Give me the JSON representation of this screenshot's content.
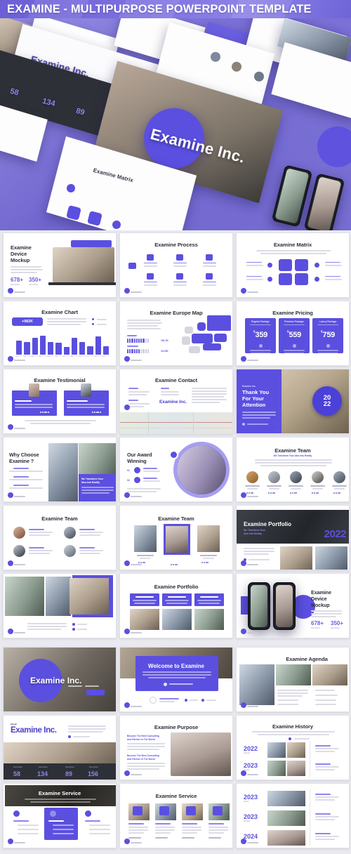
{
  "header": {
    "title": "EXAMINE - MULTIPURPOSE POWERPOINT TEMPLATE",
    "accent": "#5b4fe0",
    "gradient_from": "#6b5fd6",
    "gradient_to": "#8d83e8"
  },
  "hero": {
    "brand": "Examine Inc.",
    "circle_brand": "Examine Inc.",
    "stats": [
      {
        "value": "58",
        "label": "Description"
      },
      {
        "value": "134",
        "label": "Description"
      },
      {
        "value": "89",
        "label": "Description"
      },
      {
        "value": "156",
        "label": "Description"
      }
    ],
    "slide_titles": [
      "Examine Matrix",
      "Examine Team",
      "Examine Agenda",
      "Our Award Winning",
      "Portfolio",
      "Service"
    ]
  },
  "slides": {
    "device_mockup_1": {
      "title_l1": "Examine",
      "title_l2": "Device",
      "title_l3": "Mockup",
      "stat1": "678+",
      "stat1_cap": "Description",
      "stat2": "350+",
      "stat2_cap": "Description"
    },
    "process": {
      "title": "Examine Process",
      "node_label": "Description",
      "start_label": "Description"
    },
    "matrix": {
      "title": "Examine Matrix",
      "label": "Description"
    },
    "chart": {
      "title": "Examine Chart",
      "badge": "+982K",
      "legend": [
        "Data",
        "Chart"
      ]
    },
    "europe_map": {
      "title": "Examine Europe Map",
      "row1_label": "Stats",
      "row1_value": "151.2K",
      "row2_label": "Example",
      "row2_value": "112.5K"
    },
    "pricing": {
      "title": "Examine Pricing",
      "plans": [
        {
          "name": "Regular Package",
          "currency": "$",
          "price": "359"
        },
        {
          "name": "Premium Package",
          "currency": "$",
          "price": "559"
        },
        {
          "name": "Luxury Package",
          "currency": "$",
          "price": "759"
        }
      ]
    },
    "testimonial": {
      "title": "Examine Testimonial",
      "cards": [
        {
          "name": "Description",
          "rating_label": "Branding"
        },
        {
          "name": "Anthony W. Dafood",
          "rating_label": "Branding"
        }
      ]
    },
    "contact": {
      "title": "Examine Contact",
      "brand": "Examine Inc.",
      "labels": [
        "Location",
        "Phone",
        "Website"
      ]
    },
    "thankyou": {
      "eyebrow": "Examine Inc.",
      "l1": "Thank You",
      "l2": "For Your",
      "l3": "Attention",
      "year_top": "20",
      "year_bottom": "22"
    },
    "why_choose": {
      "l1": "Why Choose",
      "l2": "Examine ?",
      "bullets": [
        "Description",
        "Description",
        "Description"
      ],
      "overlay_l1": "We Transform Your",
      "overlay_l2": "Idea Into Reality"
    },
    "award": {
      "l1": "Our Award",
      "l2": "Winning",
      "items": [
        {
          "num": "01",
          "label": "Description"
        },
        {
          "num": "02",
          "label": "Description"
        }
      ]
    },
    "team_5": {
      "title": "Examine Team",
      "subtitle": "We Transform Your Idea Into Reality",
      "members": [
        {
          "name": "Veronica Bright",
          "role": "Creative Head"
        },
        {
          "name": "Tasha Takas",
          "role": "Art Director"
        },
        {
          "name": "Gary Wusterloi",
          "role": "Developer"
        },
        {
          "name": "Bryton Tandler",
          "role": "Manager"
        },
        {
          "name": "George Zeger",
          "role": "Designer"
        }
      ]
    },
    "team_4": {
      "title": "Examine Team",
      "members": [
        {
          "name": "Karen Okonwa",
          "role": "Creative Head"
        },
        {
          "name": "Jeffrey Lawson",
          "role": "Art Director"
        },
        {
          "name": "Christian Albert",
          "role": "Developer"
        },
        {
          "name": "Bertha Prince",
          "role": "Designer"
        }
      ]
    },
    "team_3": {
      "title": "Examine Team",
      "members": [
        {
          "name": "Gary Wusterloi",
          "role": "Creative Head"
        },
        {
          "name": "Tommy Williams",
          "role": "Art Director"
        },
        {
          "name": "Gary Wusterloi",
          "role": "Designer"
        }
      ]
    },
    "portfolio_2022": {
      "title": "Examine Portfolio",
      "sub_l1": "We Transform Your",
      "sub_l2": "Idea Into Reality",
      "year": "2022"
    },
    "portfolio_gallery": {
      "legend": [
        "Data",
        "Chart"
      ]
    },
    "portfolio_cards": {
      "title": "Examine Portfolio",
      "cards": [
        "Description",
        "Description",
        "Description"
      ]
    },
    "device_mockup_2": {
      "title_l1": "Examine",
      "title_l2": "Device",
      "title_l3": "Mockup",
      "stat1": "678+",
      "stat1_cap": "Description",
      "stat2": "350+",
      "stat2_cap": "Description"
    },
    "cover_inc": {
      "brand": "Examine Inc.",
      "cta": "Read More"
    },
    "welcome": {
      "title": "Welcome to Examine",
      "cta": "Read Our Company Profile",
      "author": "Lorraine J. Fortner",
      "author_role": "Examine Chief Officer",
      "tags": [
        "Data",
        "Chart"
      ]
    },
    "agenda": {
      "title": "Examine Agenda",
      "items": [
        "About Us",
        "Our Services",
        "Our Portfolio",
        "Our Team",
        "Pricing",
        "Contact Us",
        "Our Clients",
        "Case Study"
      ]
    },
    "about_inc": {
      "eyebrow": "About",
      "brand": "Examine Inc.",
      "stats": [
        {
          "value": "58",
          "label": "Description"
        },
        {
          "value": "134",
          "label": "Description"
        },
        {
          "value": "89",
          "label": "Description"
        },
        {
          "value": "156",
          "label": "Description"
        }
      ]
    },
    "purpose": {
      "title": "Examine Purpose",
      "items": [
        {
          "h1": "Become The Best Consulting",
          "h2": "And Partner In The World"
        },
        {
          "h1": "Become The Best Consulting",
          "h2": "And Partner In The World"
        }
      ]
    },
    "history_a": {
      "title": "Examine History",
      "rows": [
        {
          "year": "2022",
          "cap": "January",
          "label": "Description"
        },
        {
          "year": "2023",
          "cap": "August",
          "label": "Description"
        }
      ]
    },
    "history_b": {
      "rows": [
        {
          "year": "2023",
          "cap": "March",
          "label": "Description"
        },
        {
          "year": "2023",
          "cap": "October",
          "label": "Description"
        },
        {
          "year": "2024",
          "cap": "June",
          "label": "Description"
        }
      ]
    },
    "service_dark": {
      "title": "Examine Service",
      "cards": [
        {
          "label": "Description"
        },
        {
          "label": "Description"
        },
        {
          "label": "Description"
        }
      ]
    },
    "service_light": {
      "title": "Examine Service",
      "cards": [
        {
          "label": "Description",
          "price": "Rate : $ 59"
        },
        {
          "label": "Description",
          "price": "Rate : $ 79"
        },
        {
          "label": "Description",
          "price": "Rate : $ 99"
        },
        {
          "label": "Description",
          "price": "Rate : $ 119"
        }
      ]
    }
  },
  "chart_data": {
    "type": "bar",
    "title": "Examine Chart",
    "categories": [
      "Jan",
      "Feb",
      "Mar",
      "Apr",
      "May",
      "Jun",
      "Jul",
      "Aug",
      "Sep",
      "Oct",
      "Nov",
      "Dec"
    ],
    "values": [
      58,
      54,
      70,
      80,
      52,
      50,
      33,
      72,
      52,
      36,
      76,
      34
    ],
    "ylim": [
      0,
      100
    ],
    "xlabel": "",
    "ylabel": "",
    "grid": false,
    "legend_position": "right",
    "series": [
      {
        "name": "Data",
        "values": [
          58,
          54,
          70,
          80,
          52,
          50,
          33,
          72,
          52,
          36,
          76,
          34
        ]
      }
    ],
    "annotations": [
      "+982K"
    ]
  }
}
